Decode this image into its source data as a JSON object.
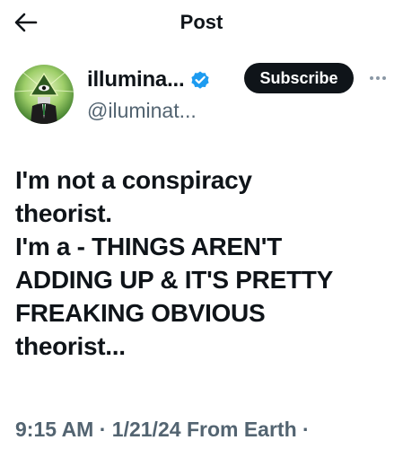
{
  "header": {
    "title": "Post"
  },
  "author": {
    "display_name": "illumina...",
    "handle": "@iluminat...",
    "subscribe_label": "Subscribe",
    "verified": true
  },
  "post": {
    "lines": [
      "I'm not a conspiracy",
      "theorist.",
      "I'm a - THINGS AREN'T",
      "ADDING UP & IT'S PRETTY",
      "FREAKING OBVIOUS",
      "theorist..."
    ]
  },
  "meta": {
    "time": "9:15 AM",
    "separator": "·",
    "date": "1/21/24",
    "source": "From Earth",
    "trailing_separator": "·"
  },
  "colors": {
    "text_primary": "#0f1419",
    "text_secondary": "#536471",
    "verified_blue": "#1d9bf0",
    "button_dark": "#0f1419"
  },
  "icons": {
    "back": "arrow-left-icon",
    "verified": "verified-badge-icon",
    "more": "more-dots-icon"
  }
}
